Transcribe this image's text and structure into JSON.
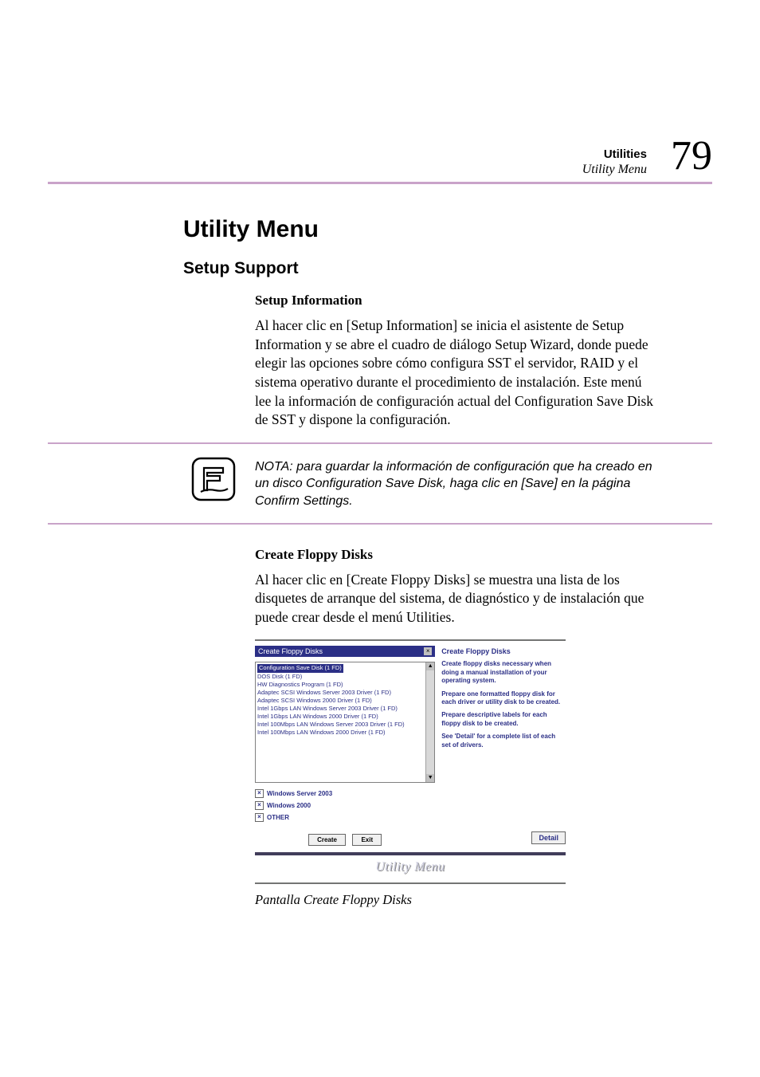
{
  "header": {
    "title_bold": "Utilities",
    "title_italic": "Utility Menu",
    "page_number": "79"
  },
  "h1": "Utility Menu",
  "h2": "Setup Support",
  "section1": {
    "heading": "Setup Information",
    "body": "Al hacer clic en [Setup Information] se inicia el asistente de Setup Information y se abre el cuadro de diálogo Setup Wizard, donde puede elegir las opciones sobre cómo configura SST el servidor, RAID y el sistema operativo durante el procedimiento de instalación. Este menú lee la información de configuración actual del Configuration Save Disk de SST y dispone la configuración."
  },
  "note": {
    "text": "NOTA: para guardar la información de configuración que ha creado en un disco Configuration Save Disk, haga clic en [Save] en la página Confirm Settings."
  },
  "section2": {
    "heading": "Create Floppy Disks",
    "body": "Al hacer clic en [Create Floppy Disks] se muestra una lista de los disquetes de arranque del sistema, de diagnóstico y de instalación que puede crear desde el menú Utilities."
  },
  "screenshot": {
    "left_panel_title": "Create Floppy Disks",
    "list_items": [
      "Configuration Save Disk (1 FD)",
      "DOS Disk (1 FD)",
      "HW Diagnostics Program (1 FD)",
      "Adaptec SCSI Windows Server 2003 Driver (1 FD)",
      "Adaptec SCSI Windows 2000 Driver (1 FD)",
      "Intel 1Gbps LAN Windows Server 2003 Driver (1 FD)",
      "Intel 1Gbps LAN Windows 2000 Driver (1 FD)",
      "Intel 100Mbps LAN Windows Server 2003 Driver (1 FD)",
      "Intel 100Mbps LAN Windows 2000 Driver (1 FD)"
    ],
    "selected_index": 0,
    "checks": [
      {
        "label": "Windows Server 2003",
        "checked": true
      },
      {
        "label": "Windows 2000",
        "checked": true
      },
      {
        "label": "OTHER",
        "checked": true
      }
    ],
    "btn_create": "Create",
    "btn_exit": "Exit",
    "right_title": "Create Floppy Disks",
    "right_paras": [
      "Create floppy disks necessary when doing a manual installation of your operating system.",
      "Prepare one formatted floppy disk for each driver or utility disk to be created.",
      "Prepare descriptive labels for each floppy disk to be created.",
      "See 'Detail' for a complete list of each set of drivers."
    ],
    "btn_detail": "Detail",
    "footer_label": "Utility Menu"
  },
  "caption": "Pantalla Create Floppy Disks"
}
